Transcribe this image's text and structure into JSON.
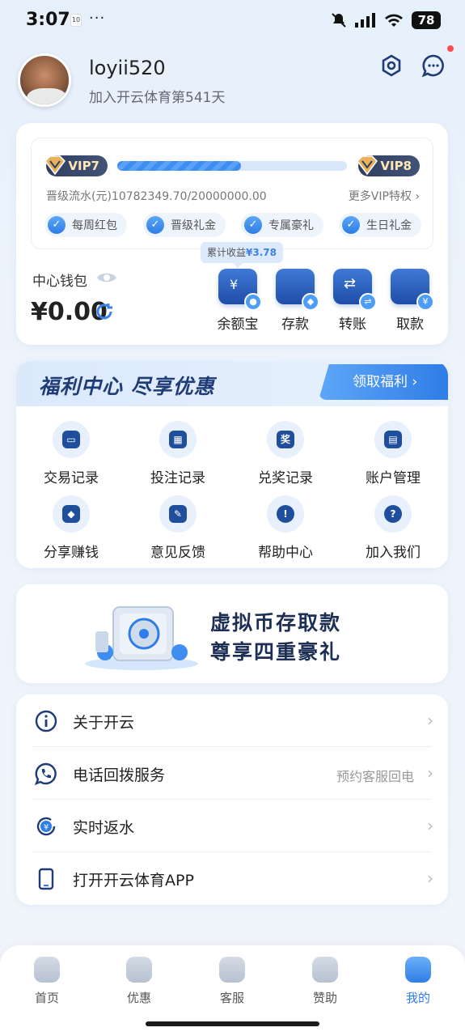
{
  "status_bar": {
    "time": "3:07",
    "calendar_day": "10",
    "dots": "···",
    "battery": "78"
  },
  "profile": {
    "username": "loyii520",
    "join_text": "加入开云体育第541天"
  },
  "vip": {
    "current_level": "VIP7",
    "next_level": "VIP8",
    "progress_fraction": 0.54,
    "promotion_text": "晋级流水(元)10782349.70/20000000.00",
    "more_link": "更多VIP特权 ›",
    "perks": [
      "每周红包",
      "晋级礼金",
      "专属豪礼",
      "生日礼金"
    ]
  },
  "wallet": {
    "label": "中心钱包",
    "balance": "¥0.00",
    "tooltip_label": "累计收益",
    "tooltip_value": "¥3.78",
    "actions": [
      "余额宝",
      "存款",
      "转账",
      "取款"
    ]
  },
  "welfare": {
    "title": "福利中心 尽享优惠",
    "button": "领取福利 ›",
    "items": [
      "交易记录",
      "投注记录",
      "兑奖记录",
      "账户管理",
      "分享赚钱",
      "意见反馈",
      "帮助中心",
      "加入我们"
    ]
  },
  "banner": {
    "line1": "虚拟币存取款",
    "line2": "尊享四重豪礼"
  },
  "menu": [
    {
      "label": "关于开云",
      "sub": ""
    },
    {
      "label": "电话回拨服务",
      "sub": "预约客服回电"
    },
    {
      "label": "实时返水",
      "sub": ""
    },
    {
      "label": "打开开云体育APP",
      "sub": ""
    }
  ],
  "tabs": [
    "首页",
    "优惠",
    "客服",
    "赞助",
    "我的"
  ],
  "colors": {
    "accent": "#2f7de6",
    "navy": "#1f4f9c",
    "vip_badge": "#2f3f62"
  },
  "icons": {
    "menu": [
      "info-icon",
      "phone-icon",
      "rebate-icon",
      "mobile-icon"
    ],
    "grid": [
      "wallet-icon",
      "calendar-icon",
      "prize-icon",
      "account-card-icon",
      "handshake-icon",
      "edit-icon",
      "help-icon",
      "question-icon"
    ]
  }
}
